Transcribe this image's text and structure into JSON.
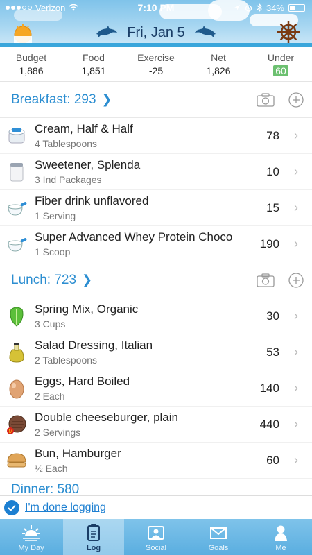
{
  "status": {
    "carrier": "Verizon",
    "time": "7:10 PM",
    "battery": "34%",
    "battery_level": 0.34
  },
  "header": {
    "date": "Fri, Jan 5"
  },
  "summary": [
    {
      "label": "Budget",
      "value": "1,886"
    },
    {
      "label": "Food",
      "value": "1,851"
    },
    {
      "label": "Exercise",
      "value": "-25"
    },
    {
      "label": "Net",
      "value": "1,826"
    },
    {
      "label": "Under",
      "value": "60"
    }
  ],
  "meals": [
    {
      "title": "Breakfast: 293",
      "items": [
        {
          "name": "Cream, Half & Half",
          "serving": "4 Tablespoons",
          "cal": "78",
          "icon": "cream-cup-icon"
        },
        {
          "name": "Sweetener, Splenda",
          "serving": "3 Ind Packages",
          "cal": "10",
          "icon": "jar-icon"
        },
        {
          "name": "Fiber drink unflavored",
          "serving": "1 Serving",
          "cal": "15",
          "icon": "measuring-cup-icon"
        },
        {
          "name": "Super Advanced Whey Protein Choco",
          "serving": "1 Scoop",
          "cal": "190",
          "icon": "measuring-cup-icon"
        }
      ]
    },
    {
      "title": "Lunch: 723",
      "items": [
        {
          "name": "Spring Mix, Organic",
          "serving": "3 Cups",
          "cal": "30",
          "icon": "lettuce-icon"
        },
        {
          "name": "Salad Dressing, Italian",
          "serving": "2 Tablespoons",
          "cal": "53",
          "icon": "oil-bottle-icon"
        },
        {
          "name": "Eggs, Hard Boiled",
          "serving": "2 Each",
          "cal": "140",
          "icon": "egg-icon"
        },
        {
          "name": "Double cheeseburger, plain",
          "serving": "2 Servings",
          "cal": "440",
          "icon": "burger-patty-icon"
        },
        {
          "name": "Bun, Hamburger",
          "serving": "½ Each",
          "cal": "60",
          "icon": "bun-icon"
        }
      ]
    }
  ],
  "dinner_peek": "Dinner: 580",
  "done_label": "I'm done logging",
  "tabs": [
    {
      "label": "My Day",
      "icon": "sunrise-icon"
    },
    {
      "label": "Log",
      "icon": "clipboard-icon"
    },
    {
      "label": "Social",
      "icon": "social-icon"
    },
    {
      "label": "Goals",
      "icon": "envelope-icon"
    },
    {
      "label": "Me",
      "icon": "person-icon"
    }
  ]
}
